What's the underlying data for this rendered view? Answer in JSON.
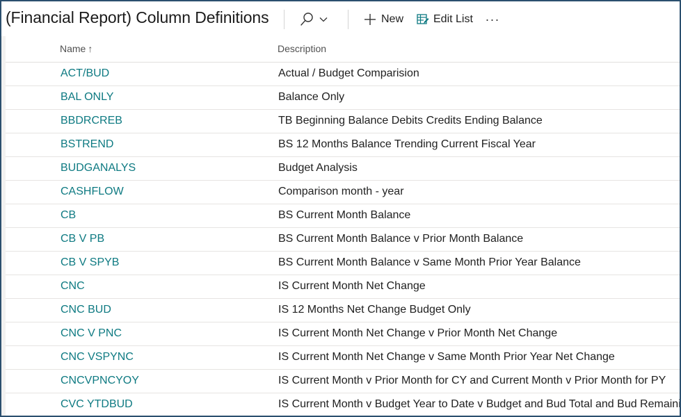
{
  "page": {
    "title": "(Financial Report) Column Definitions"
  },
  "toolbar": {
    "new_label": "New",
    "edit_list_label": "Edit List",
    "more_label": "···"
  },
  "columns": {
    "name": "Name",
    "name_sort": "↑",
    "description": "Description"
  },
  "rows": [
    {
      "name": "ACT/BUD",
      "description": "Actual / Budget Comparision"
    },
    {
      "name": "BAL ONLY",
      "description": "Balance Only"
    },
    {
      "name": "BBDRCREB",
      "description": "TB Beginning Balance Debits Credits Ending Balance"
    },
    {
      "name": "BSTREND",
      "description": "BS 12 Months Balance Trending Current Fiscal Year"
    },
    {
      "name": "BUDGANALYS",
      "description": "Budget Analysis"
    },
    {
      "name": "CASHFLOW",
      "description": "Comparison month - year"
    },
    {
      "name": "CB",
      "description": "BS Current Month Balance"
    },
    {
      "name": "CB V PB",
      "description": "BS Current Month Balance v Prior Month Balance"
    },
    {
      "name": "CB V SPYB",
      "description": "BS Current Month Balance v Same Month Prior Year Balance"
    },
    {
      "name": "CNC",
      "description": "IS Current Month Net Change"
    },
    {
      "name": "CNC BUD",
      "description": "IS 12 Months Net Change Budget Only"
    },
    {
      "name": "CNC V PNC",
      "description": "IS Current Month Net Change v Prior Month Net Change"
    },
    {
      "name": "CNC VSPYNC",
      "description": "IS Current Month Net Change v Same Month Prior Year Net Change"
    },
    {
      "name": "CNCVPNCYOY",
      "description": "IS Current Month v Prior Month for CY and Current Month v Prior Month for PY"
    },
    {
      "name": "CVC YTDBUD",
      "description": "IS Current Month v Budget Year to Date v Budget and Bud Total and Bud Remaining"
    }
  ],
  "colors": {
    "link": "#0e7a82",
    "frame_border": "#2b4f6e",
    "edit_icon": "#0e7a82"
  }
}
